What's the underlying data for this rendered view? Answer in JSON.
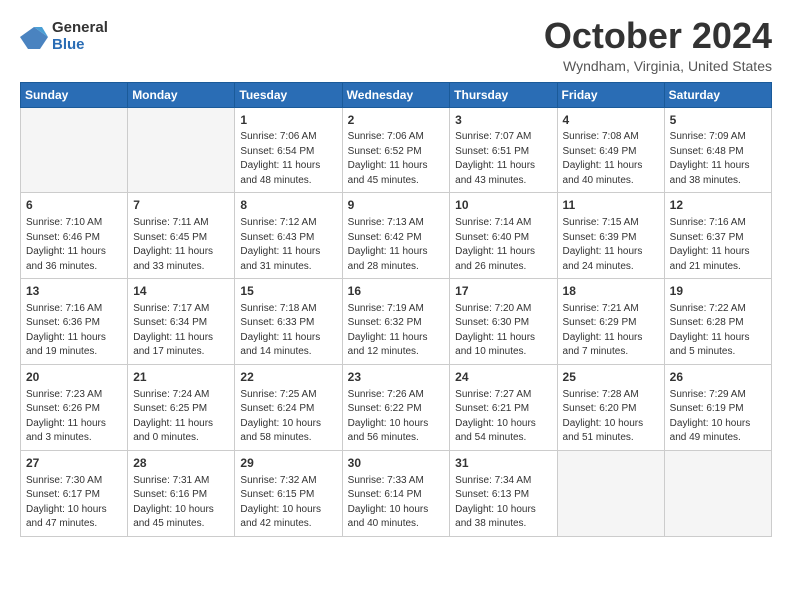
{
  "logo": {
    "general": "General",
    "blue": "Blue"
  },
  "header": {
    "month": "October 2024",
    "location": "Wyndham, Virginia, United States"
  },
  "weekdays": [
    "Sunday",
    "Monday",
    "Tuesday",
    "Wednesday",
    "Thursday",
    "Friday",
    "Saturday"
  ],
  "weeks": [
    [
      {
        "day": "",
        "sunrise": "",
        "sunset": "",
        "daylight": ""
      },
      {
        "day": "",
        "sunrise": "",
        "sunset": "",
        "daylight": ""
      },
      {
        "day": "1",
        "sunrise": "Sunrise: 7:06 AM",
        "sunset": "Sunset: 6:54 PM",
        "daylight": "Daylight: 11 hours and 48 minutes."
      },
      {
        "day": "2",
        "sunrise": "Sunrise: 7:06 AM",
        "sunset": "Sunset: 6:52 PM",
        "daylight": "Daylight: 11 hours and 45 minutes."
      },
      {
        "day": "3",
        "sunrise": "Sunrise: 7:07 AM",
        "sunset": "Sunset: 6:51 PM",
        "daylight": "Daylight: 11 hours and 43 minutes."
      },
      {
        "day": "4",
        "sunrise": "Sunrise: 7:08 AM",
        "sunset": "Sunset: 6:49 PM",
        "daylight": "Daylight: 11 hours and 40 minutes."
      },
      {
        "day": "5",
        "sunrise": "Sunrise: 7:09 AM",
        "sunset": "Sunset: 6:48 PM",
        "daylight": "Daylight: 11 hours and 38 minutes."
      }
    ],
    [
      {
        "day": "6",
        "sunrise": "Sunrise: 7:10 AM",
        "sunset": "Sunset: 6:46 PM",
        "daylight": "Daylight: 11 hours and 36 minutes."
      },
      {
        "day": "7",
        "sunrise": "Sunrise: 7:11 AM",
        "sunset": "Sunset: 6:45 PM",
        "daylight": "Daylight: 11 hours and 33 minutes."
      },
      {
        "day": "8",
        "sunrise": "Sunrise: 7:12 AM",
        "sunset": "Sunset: 6:43 PM",
        "daylight": "Daylight: 11 hours and 31 minutes."
      },
      {
        "day": "9",
        "sunrise": "Sunrise: 7:13 AM",
        "sunset": "Sunset: 6:42 PM",
        "daylight": "Daylight: 11 hours and 28 minutes."
      },
      {
        "day": "10",
        "sunrise": "Sunrise: 7:14 AM",
        "sunset": "Sunset: 6:40 PM",
        "daylight": "Daylight: 11 hours and 26 minutes."
      },
      {
        "day": "11",
        "sunrise": "Sunrise: 7:15 AM",
        "sunset": "Sunset: 6:39 PM",
        "daylight": "Daylight: 11 hours and 24 minutes."
      },
      {
        "day": "12",
        "sunrise": "Sunrise: 7:16 AM",
        "sunset": "Sunset: 6:37 PM",
        "daylight": "Daylight: 11 hours and 21 minutes."
      }
    ],
    [
      {
        "day": "13",
        "sunrise": "Sunrise: 7:16 AM",
        "sunset": "Sunset: 6:36 PM",
        "daylight": "Daylight: 11 hours and 19 minutes."
      },
      {
        "day": "14",
        "sunrise": "Sunrise: 7:17 AM",
        "sunset": "Sunset: 6:34 PM",
        "daylight": "Daylight: 11 hours and 17 minutes."
      },
      {
        "day": "15",
        "sunrise": "Sunrise: 7:18 AM",
        "sunset": "Sunset: 6:33 PM",
        "daylight": "Daylight: 11 hours and 14 minutes."
      },
      {
        "day": "16",
        "sunrise": "Sunrise: 7:19 AM",
        "sunset": "Sunset: 6:32 PM",
        "daylight": "Daylight: 11 hours and 12 minutes."
      },
      {
        "day": "17",
        "sunrise": "Sunrise: 7:20 AM",
        "sunset": "Sunset: 6:30 PM",
        "daylight": "Daylight: 11 hours and 10 minutes."
      },
      {
        "day": "18",
        "sunrise": "Sunrise: 7:21 AM",
        "sunset": "Sunset: 6:29 PM",
        "daylight": "Daylight: 11 hours and 7 minutes."
      },
      {
        "day": "19",
        "sunrise": "Sunrise: 7:22 AM",
        "sunset": "Sunset: 6:28 PM",
        "daylight": "Daylight: 11 hours and 5 minutes."
      }
    ],
    [
      {
        "day": "20",
        "sunrise": "Sunrise: 7:23 AM",
        "sunset": "Sunset: 6:26 PM",
        "daylight": "Daylight: 11 hours and 3 minutes."
      },
      {
        "day": "21",
        "sunrise": "Sunrise: 7:24 AM",
        "sunset": "Sunset: 6:25 PM",
        "daylight": "Daylight: 11 hours and 0 minutes."
      },
      {
        "day": "22",
        "sunrise": "Sunrise: 7:25 AM",
        "sunset": "Sunset: 6:24 PM",
        "daylight": "Daylight: 10 hours and 58 minutes."
      },
      {
        "day": "23",
        "sunrise": "Sunrise: 7:26 AM",
        "sunset": "Sunset: 6:22 PM",
        "daylight": "Daylight: 10 hours and 56 minutes."
      },
      {
        "day": "24",
        "sunrise": "Sunrise: 7:27 AM",
        "sunset": "Sunset: 6:21 PM",
        "daylight": "Daylight: 10 hours and 54 minutes."
      },
      {
        "day": "25",
        "sunrise": "Sunrise: 7:28 AM",
        "sunset": "Sunset: 6:20 PM",
        "daylight": "Daylight: 10 hours and 51 minutes."
      },
      {
        "day": "26",
        "sunrise": "Sunrise: 7:29 AM",
        "sunset": "Sunset: 6:19 PM",
        "daylight": "Daylight: 10 hours and 49 minutes."
      }
    ],
    [
      {
        "day": "27",
        "sunrise": "Sunrise: 7:30 AM",
        "sunset": "Sunset: 6:17 PM",
        "daylight": "Daylight: 10 hours and 47 minutes."
      },
      {
        "day": "28",
        "sunrise": "Sunrise: 7:31 AM",
        "sunset": "Sunset: 6:16 PM",
        "daylight": "Daylight: 10 hours and 45 minutes."
      },
      {
        "day": "29",
        "sunrise": "Sunrise: 7:32 AM",
        "sunset": "Sunset: 6:15 PM",
        "daylight": "Daylight: 10 hours and 42 minutes."
      },
      {
        "day": "30",
        "sunrise": "Sunrise: 7:33 AM",
        "sunset": "Sunset: 6:14 PM",
        "daylight": "Daylight: 10 hours and 40 minutes."
      },
      {
        "day": "31",
        "sunrise": "Sunrise: 7:34 AM",
        "sunset": "Sunset: 6:13 PM",
        "daylight": "Daylight: 10 hours and 38 minutes."
      },
      {
        "day": "",
        "sunrise": "",
        "sunset": "",
        "daylight": ""
      },
      {
        "day": "",
        "sunrise": "",
        "sunset": "",
        "daylight": ""
      }
    ]
  ]
}
